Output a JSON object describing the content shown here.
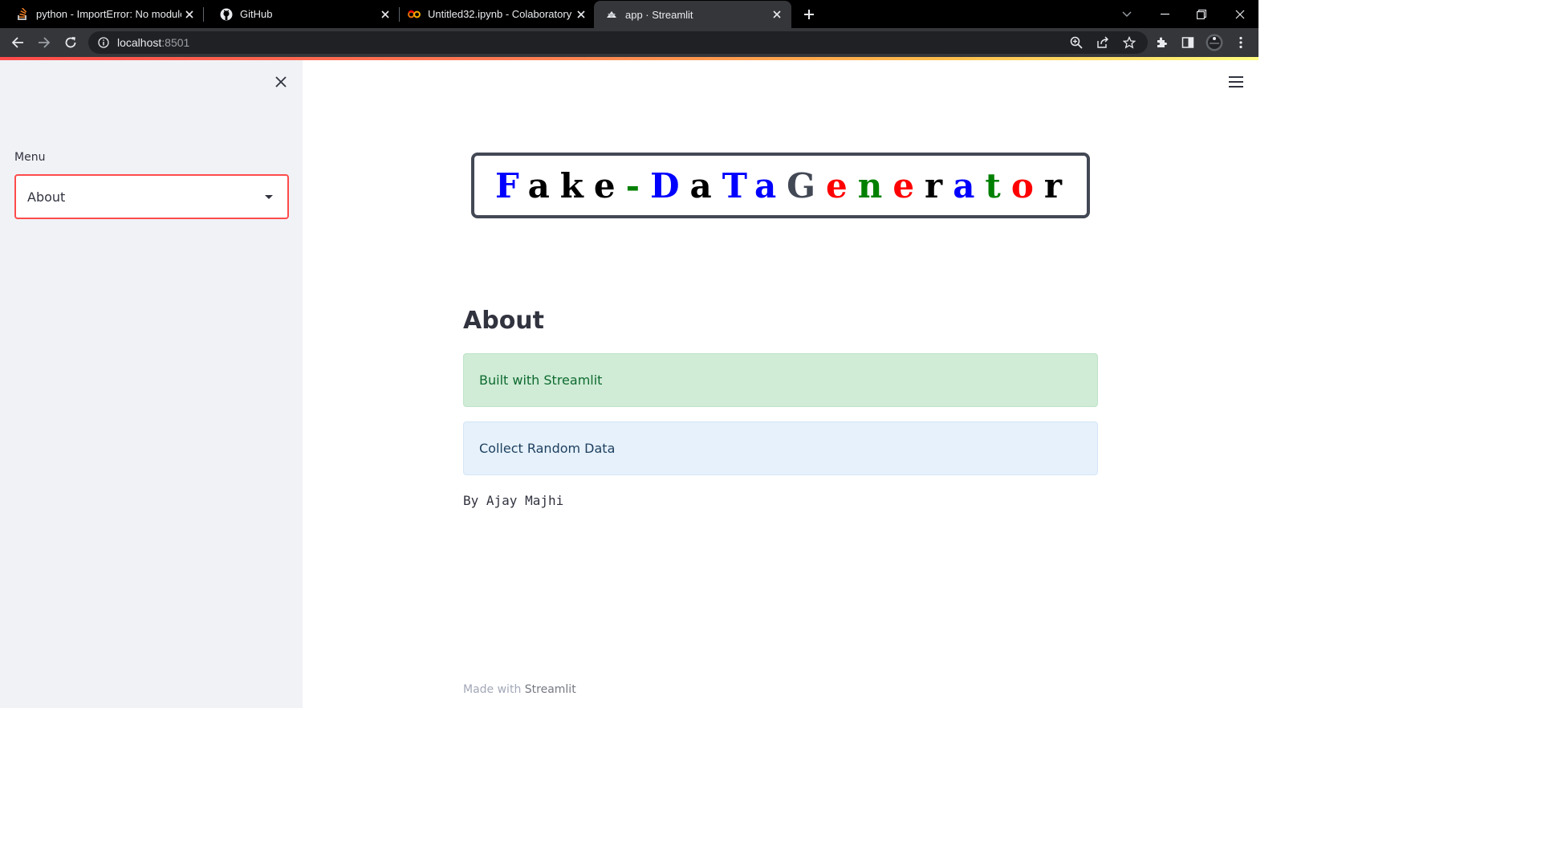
{
  "browser": {
    "tabs": [
      {
        "title": "python - ImportError: No module named",
        "icon": "stackoverflow-icon",
        "active": false
      },
      {
        "title": "GitHub",
        "icon": "github-icon",
        "active": false
      },
      {
        "title": "Untitled32.ipynb - Colaboratory",
        "icon": "colab-icon",
        "active": false
      },
      {
        "title": "app · Streamlit",
        "icon": "streamlit-icon",
        "active": true
      }
    ],
    "url_host": "localhost",
    "url_port": ":8501"
  },
  "sidebar": {
    "label": "Menu",
    "select_value": "About"
  },
  "main": {
    "title_letters": [
      {
        "ch": "F",
        "color": "#0000ff"
      },
      {
        "ch": "a",
        "color": "#000000"
      },
      {
        "ch": "k",
        "color": "#000000"
      },
      {
        "ch": "e",
        "color": "#000000"
      },
      {
        "ch": "-",
        "color": "#008000"
      },
      {
        "ch": "D",
        "color": "#0000ff"
      },
      {
        "ch": "a",
        "color": "#000000"
      },
      {
        "ch": "T",
        "color": "#0000ff"
      },
      {
        "ch": "a",
        "color": "#0000ff"
      },
      {
        "ch": "G",
        "color": "#434855"
      },
      {
        "ch": "e",
        "color": "#ff0000"
      },
      {
        "ch": "n",
        "color": "#008000"
      },
      {
        "ch": "e",
        "color": "#ff0000"
      },
      {
        "ch": "r",
        "color": "#000000"
      },
      {
        "ch": "a",
        "color": "#0000ff"
      },
      {
        "ch": "t",
        "color": "#008000"
      },
      {
        "ch": "o",
        "color": "#ff0000"
      },
      {
        "ch": "r",
        "color": "#000000"
      }
    ],
    "heading": "About",
    "success_text": "Built with Streamlit",
    "info_text": "Collect Random Data",
    "author_text": "By Ajay Majhi",
    "footer_prefix": "Made with ",
    "footer_brand": "Streamlit"
  },
  "colors": {
    "accent": "#ff4b4b",
    "sidebar_bg": "#f0f2f6",
    "success_bg": "#d0ecd6",
    "info_bg": "#e6f1fb"
  }
}
